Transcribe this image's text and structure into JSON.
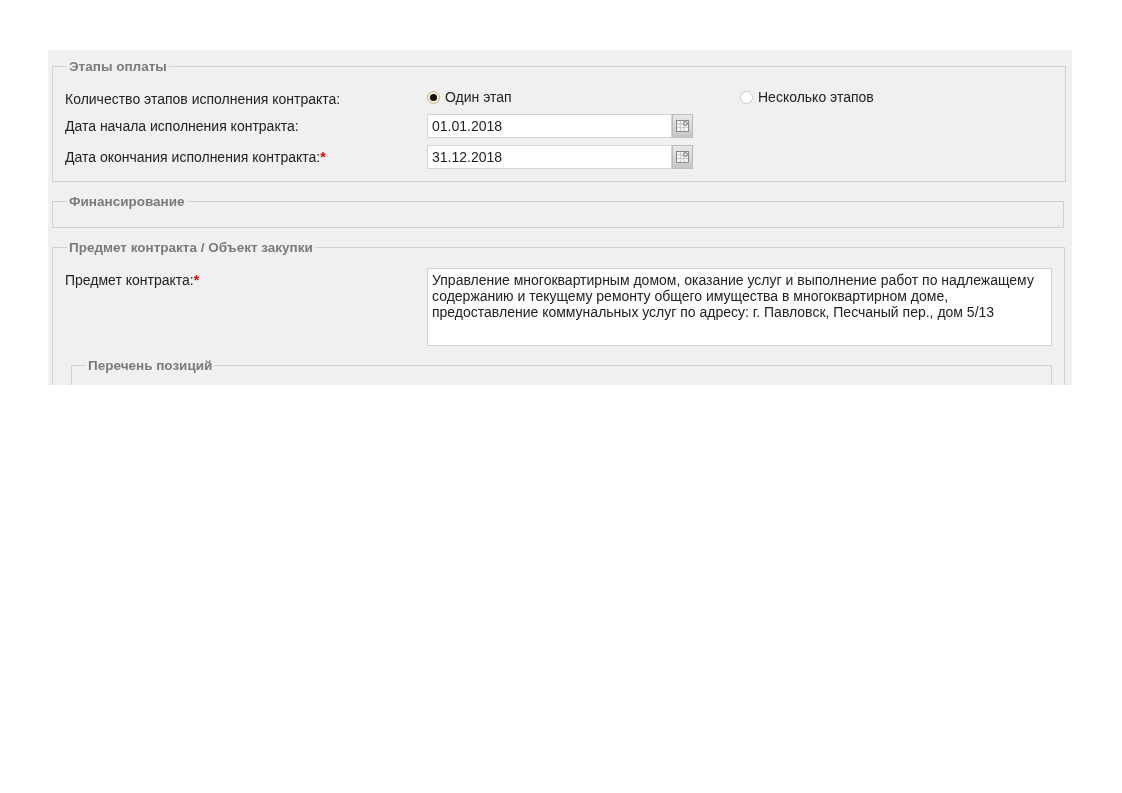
{
  "sections": [
    {
      "legend": "Этапы оплаты",
      "fields": [
        {
          "kind": "radio",
          "label": "Количество этапов исполнения контракта:",
          "options": [
            {
              "label": "Один этап",
              "selected": true
            },
            {
              "label": "Несколько этапов",
              "selected": false
            }
          ]
        },
        {
          "kind": "date",
          "label": "Дата начала исполнения контракта:",
          "value": "01.01.2018"
        },
        {
          "kind": "date",
          "label": "Дата окончания исполнения контракта:",
          "mark": "*",
          "value": "31.12.2018"
        }
      ]
    },
    {
      "legend": "Финансирование"
    },
    {
      "legend": "Предмет контракта / Объект закупки",
      "fields": [
        {
          "kind": "textarea",
          "label": "Предмет контракта:",
          "mark": "*",
          "value": "Управление многоквартирным домом, оказание услуг и выполнение работ по надлежащему содержанию и текущему ремонту общего имущества в многоквартирном доме, предоставление коммунальных услуг по адресу: г. Павловск, Песчаный пер., дом 5/13"
        }
      ],
      "subsections": [
        {
          "legend": "Перечень позиций"
        }
      ]
    }
  ]
}
